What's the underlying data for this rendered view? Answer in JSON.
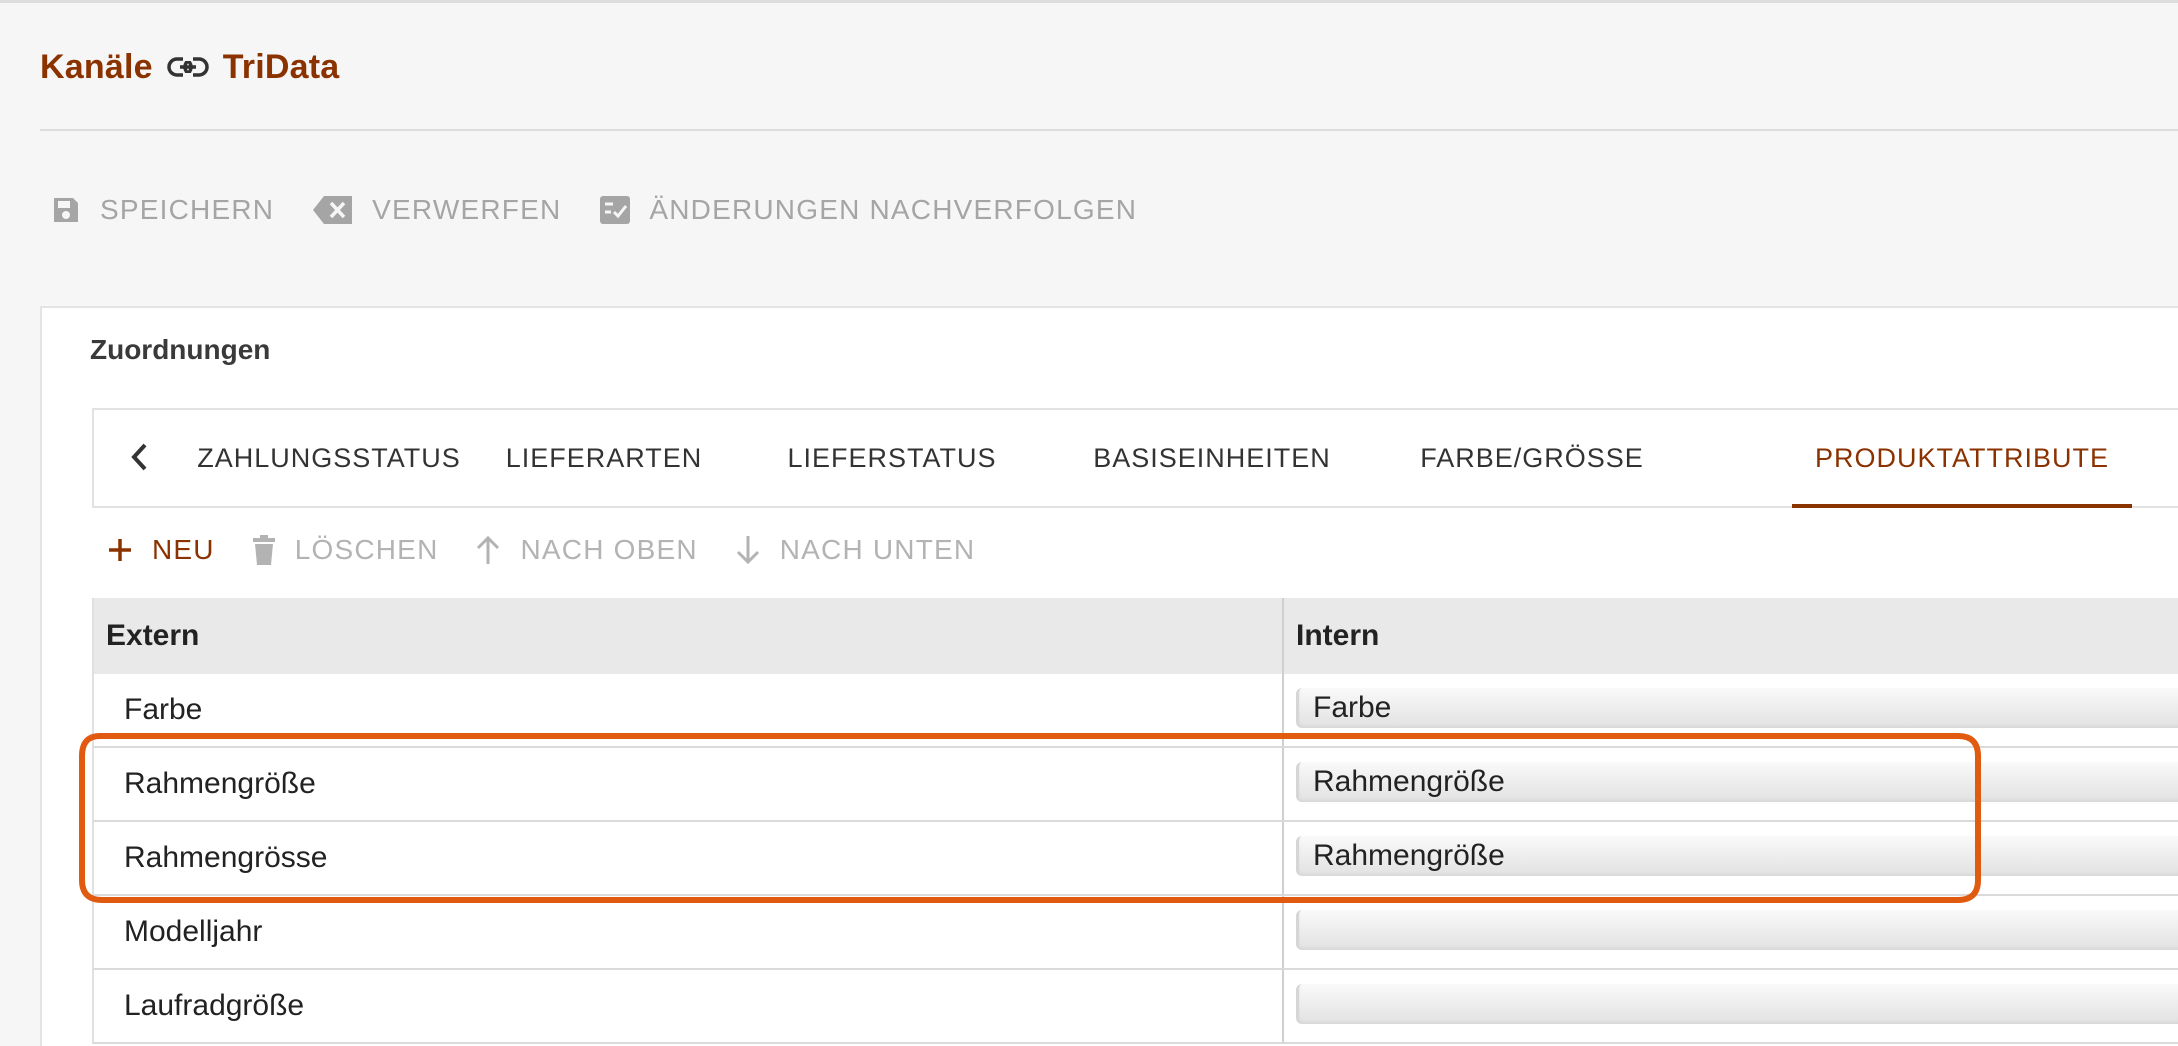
{
  "header": {
    "crumbs": [
      "Kanäle",
      "TriData"
    ],
    "separator_icon": "link-icon"
  },
  "toolbar": {
    "save_label": "SPEICHERN",
    "discard_label": "VERWERFEN",
    "track_label": "ÄNDERUNGEN NACHVERFOLGEN"
  },
  "card": {
    "title": "Zuordnungen",
    "tabs": [
      {
        "label": "ZAHLUNGSSTATUS",
        "active": false
      },
      {
        "label": "LIEFERARTEN",
        "active": false
      },
      {
        "label": "LIEFERSTATUS",
        "active": false
      },
      {
        "label": "BASISEINHEITEN",
        "active": false
      },
      {
        "label": "FARBE/GRÖSSE",
        "active": false
      },
      {
        "label": "PRODUKTATTRIBUTE",
        "active": true
      }
    ],
    "actions": {
      "new_label": "NEU",
      "delete_label": "LÖSCHEN",
      "up_label": "NACH OBEN",
      "down_label": "NACH UNTEN"
    },
    "table": {
      "columns": [
        "Extern",
        "Intern"
      ],
      "rows": [
        {
          "extern": "Farbe",
          "intern": "Farbe"
        },
        {
          "extern": "Rahmengröße",
          "intern": "Rahmengröße"
        },
        {
          "extern": "Rahmengrösse",
          "intern": "Rahmengröße"
        },
        {
          "extern": "Modelljahr",
          "intern": ""
        },
        {
          "extern": "Laufradgröße",
          "intern": ""
        }
      ]
    }
  },
  "colors": {
    "accent": "#8a3200",
    "annotation": "#e05a10",
    "disabled": "#a5a5a5"
  }
}
